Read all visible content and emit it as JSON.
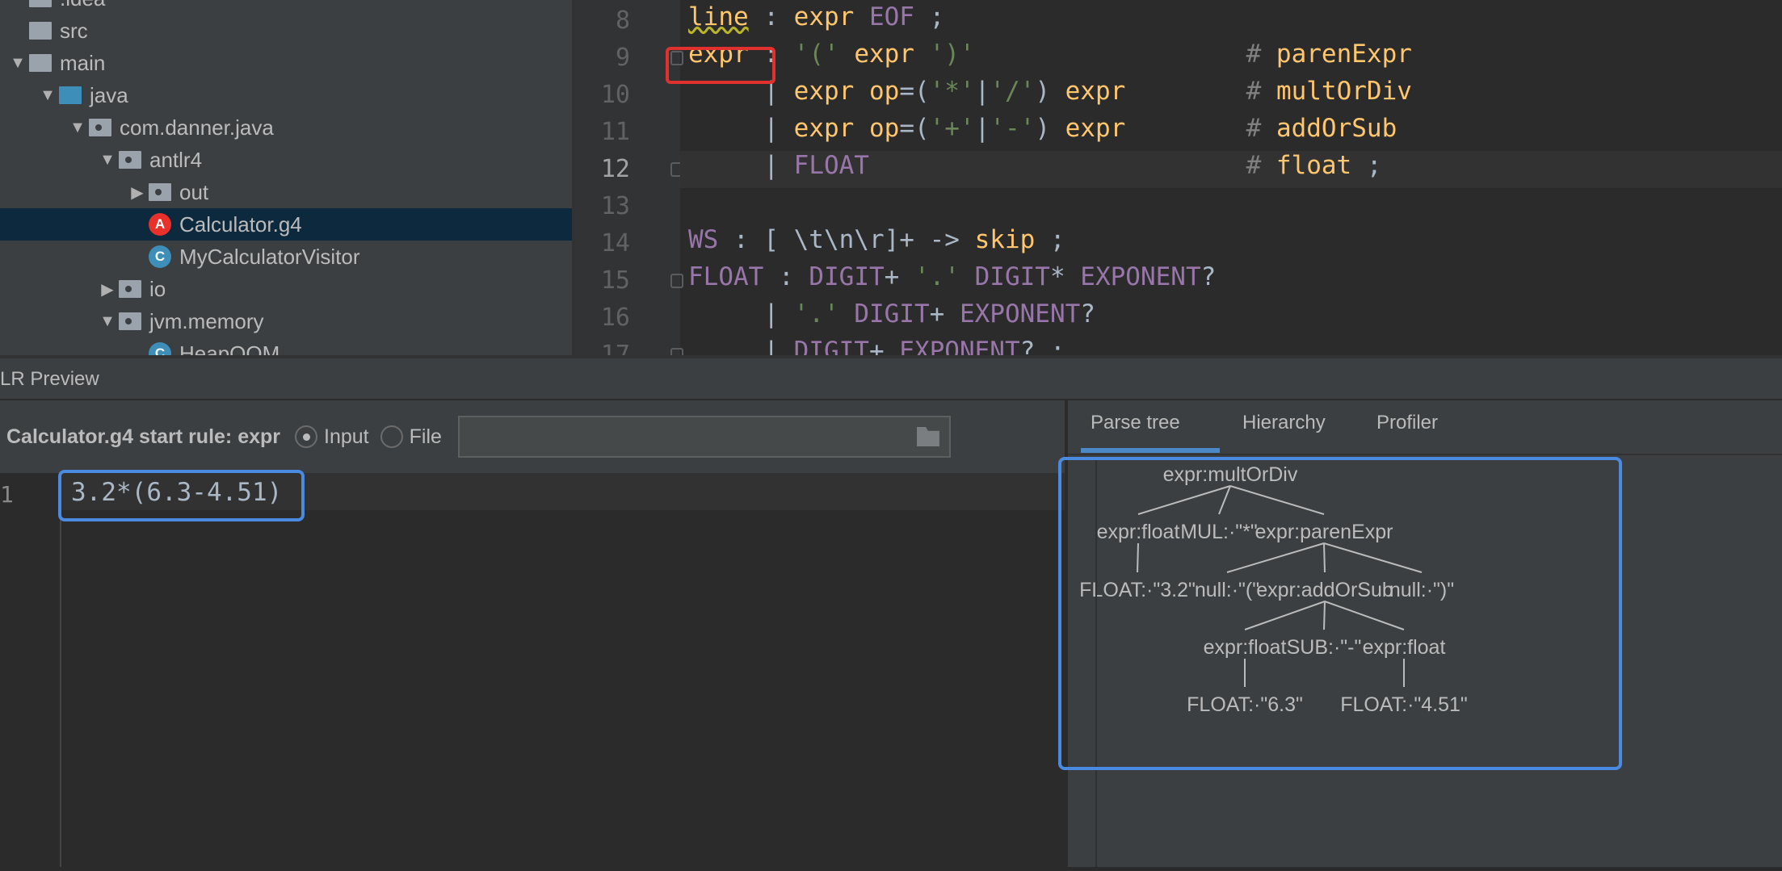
{
  "project_tree": [
    {
      "label": ".idea",
      "arrow": "",
      "icon": "folder",
      "level": 0
    },
    {
      "label": "src",
      "arrow": "",
      "icon": "folder",
      "level": 0
    },
    {
      "label": "main",
      "arrow": "down",
      "icon": "folder",
      "level": 0
    },
    {
      "label": "java",
      "arrow": "down",
      "icon": "folder-blue",
      "level": 1
    },
    {
      "label": "com.danner.java",
      "arrow": "down",
      "icon": "package",
      "level": 2
    },
    {
      "label": "antlr4",
      "arrow": "down",
      "icon": "package",
      "level": 3
    },
    {
      "label": "out",
      "arrow": "right",
      "icon": "package",
      "level": 4
    },
    {
      "label": "Calculator.g4",
      "arrow": "",
      "icon": "antlr-file",
      "level": 4,
      "selected": true
    },
    {
      "label": "MyCalculatorVisitor",
      "arrow": "",
      "icon": "class",
      "level": 4
    },
    {
      "label": "io",
      "arrow": "right",
      "icon": "package",
      "level": 3
    },
    {
      "label": "jvm.memory",
      "arrow": "down",
      "icon": "package",
      "level": 3
    },
    {
      "label": "HeapOOM",
      "arrow": "",
      "icon": "class-runnable",
      "level": 4
    }
  ],
  "editor": {
    "current_line": 12,
    "lines": [
      {
        "n": "8",
        "tokens": [
          [
            "line",
            "o squig"
          ],
          [
            " : ",
            "w"
          ],
          [
            "expr",
            "o"
          ],
          [
            " EOF",
            "p"
          ],
          [
            " ;",
            "w"
          ]
        ]
      },
      {
        "n": "9",
        "tokens": [
          [
            "expr",
            "o"
          ],
          [
            " : ",
            "w"
          ],
          [
            "'('",
            "g"
          ],
          [
            " expr ",
            "o"
          ],
          [
            "')'",
            "g"
          ],
          [
            "                  ",
            "w"
          ],
          [
            "# ",
            "c"
          ],
          [
            "parenExpr",
            "o"
          ]
        ]
      },
      {
        "n": "10",
        "tokens": [
          [
            "     | ",
            "w"
          ],
          [
            "expr",
            "o"
          ],
          [
            " op",
            "o"
          ],
          [
            "=(",
            "w"
          ],
          [
            "'*'",
            "g"
          ],
          [
            "|",
            "w"
          ],
          [
            "'/'",
            "g"
          ],
          [
            ") ",
            "w"
          ],
          [
            "expr",
            "o"
          ],
          [
            "        ",
            "w"
          ],
          [
            "# ",
            "c"
          ],
          [
            "multOrDiv",
            "o"
          ]
        ]
      },
      {
        "n": "11",
        "tokens": [
          [
            "     | ",
            "w"
          ],
          [
            "expr",
            "o"
          ],
          [
            " op",
            "o"
          ],
          [
            "=(",
            "w"
          ],
          [
            "'+'",
            "g"
          ],
          [
            "|",
            "w"
          ],
          [
            "'-'",
            "g"
          ],
          [
            ") ",
            "w"
          ],
          [
            "expr",
            "o"
          ],
          [
            "        ",
            "w"
          ],
          [
            "# ",
            "c"
          ],
          [
            "addOrSub",
            "o"
          ]
        ]
      },
      {
        "n": "12",
        "tokens": [
          [
            "     | ",
            "w"
          ],
          [
            "FLOAT",
            "p"
          ],
          [
            "                         ",
            "w"
          ],
          [
            "# ",
            "c"
          ],
          [
            "float",
            "o"
          ],
          [
            " ;",
            "w"
          ]
        ]
      },
      {
        "n": "13",
        "tokens": []
      },
      {
        "n": "14",
        "tokens": [
          [
            "WS",
            "p"
          ],
          [
            " : [ \\t\\n\\r]+ -> ",
            "w"
          ],
          [
            "skip",
            "o"
          ],
          [
            " ;",
            "w"
          ]
        ]
      },
      {
        "n": "15",
        "tokens": [
          [
            "FLOAT",
            "p"
          ],
          [
            " : ",
            "w"
          ],
          [
            "DIGIT",
            "p"
          ],
          [
            "+ ",
            "w"
          ],
          [
            "'.'",
            "g"
          ],
          [
            " DIGIT",
            "p"
          ],
          [
            "* ",
            "w"
          ],
          [
            "EXPONENT",
            "p"
          ],
          [
            "?",
            "w"
          ]
        ]
      },
      {
        "n": "16",
        "tokens": [
          [
            "     | ",
            "w"
          ],
          [
            "'.'",
            "g"
          ],
          [
            " DIGIT",
            "p"
          ],
          [
            "+ ",
            "w"
          ],
          [
            "EXPONENT",
            "p"
          ],
          [
            "?",
            "w"
          ]
        ]
      },
      {
        "n": "17",
        "tokens": [
          [
            "     | ",
            "w"
          ],
          [
            "DIGIT",
            "p"
          ],
          [
            "+ ",
            "w"
          ],
          [
            "EXPONENT",
            "p"
          ],
          [
            "? ;",
            "w"
          ]
        ]
      }
    ]
  },
  "preview": {
    "title": "LR Preview",
    "grammar_label": "Calculator.g4 start rule: expr",
    "radio_input": "Input",
    "radio_file": "File",
    "selected_source": "Input",
    "file_path": "",
    "input_line_number": "1",
    "input_text": "3.2*(6.3-4.51)",
    "tabs": [
      "Parse tree",
      "Hierarchy",
      "Profiler"
    ],
    "active_tab": "Parse tree"
  },
  "parse_tree": {
    "label": "expr:multOrDiv",
    "children": [
      {
        "label": "expr:float",
        "children": [
          {
            "label": "FLOAT:·\"3.2\"",
            "children": []
          }
        ]
      },
      {
        "label": "MUL:·\"*\"",
        "children": []
      },
      {
        "label": "expr:parenExpr",
        "children": [
          {
            "label": "null:·\"(\"",
            "children": []
          },
          {
            "label": "expr:addOrSub",
            "children": [
              {
                "label": "expr:float",
                "children": [
                  {
                    "label": "FLOAT:·\"6.3\"",
                    "children": []
                  }
                ]
              },
              {
                "label": "SUB:·\"-\"",
                "children": []
              },
              {
                "label": "expr:float",
                "children": [
                  {
                    "label": "FLOAT:·\"4.51\"",
                    "children": []
                  }
                ]
              }
            ]
          },
          {
            "label": "null:·\")\"",
            "children": []
          }
        ]
      }
    ]
  },
  "colors": {
    "accent": "#4a88c7",
    "highlight_box": "#4a8ae0",
    "error_box": "#e0312e",
    "selection": "#0d293e"
  }
}
